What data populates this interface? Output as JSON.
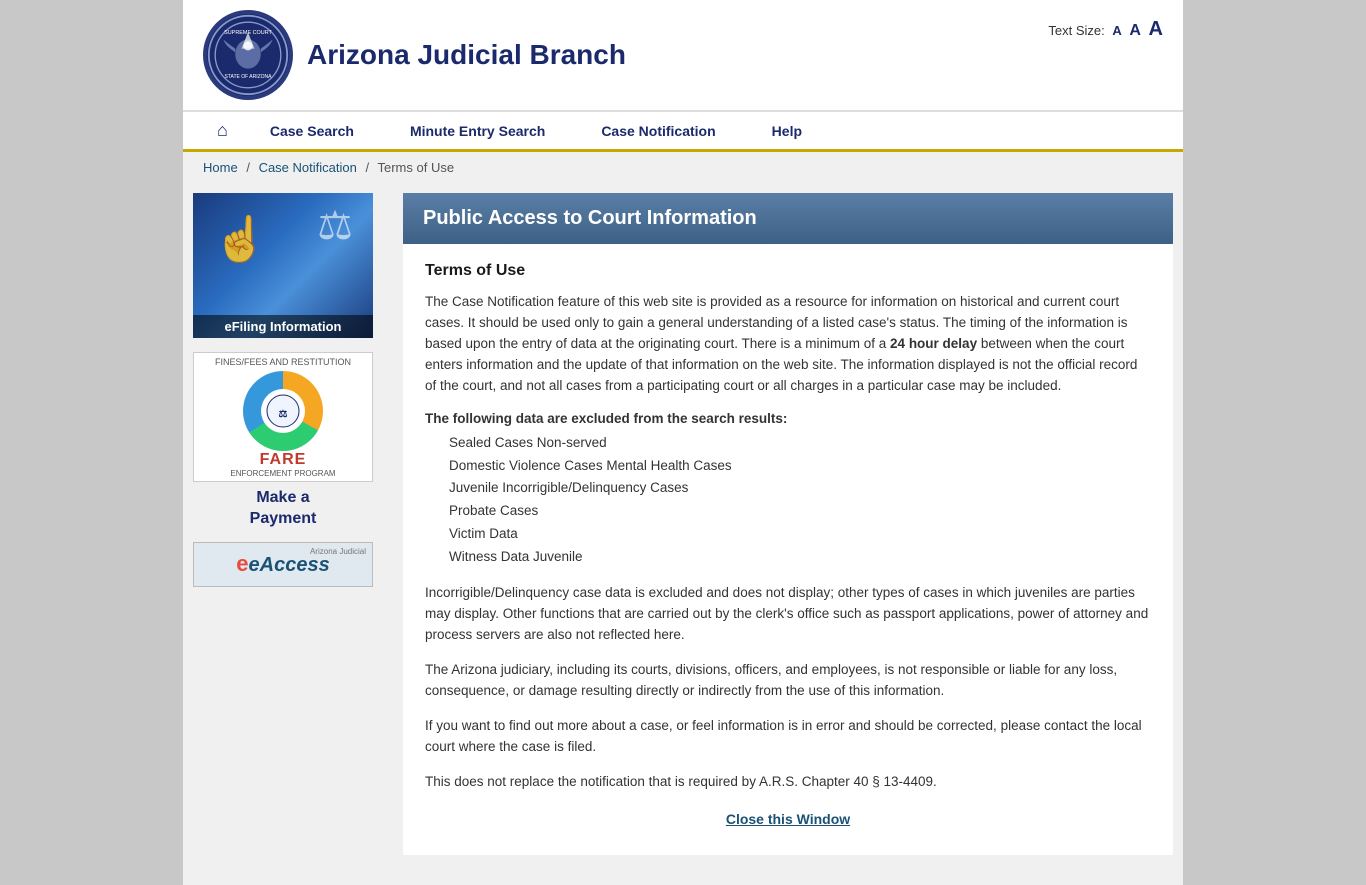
{
  "header": {
    "title": "Arizona Judicial Branch",
    "text_size_label": "Text Size:",
    "text_size_small": "A",
    "text_size_medium": "A",
    "text_size_large": "A"
  },
  "nav": {
    "home_title": "Home",
    "links": [
      {
        "id": "case-search",
        "label": "Case Search"
      },
      {
        "id": "minute-entry-search",
        "label": "Minute Entry Search"
      },
      {
        "id": "case-notification",
        "label": "Case Notification"
      },
      {
        "id": "help",
        "label": "Help"
      }
    ]
  },
  "breadcrumb": {
    "items": [
      "Home",
      "Case Notification",
      "Terms of Use"
    ],
    "separators": [
      "/",
      "/"
    ]
  },
  "sidebar": {
    "efiling_label": "eFiling Information",
    "fare_label_top": "FINES/FEES AND RESTITUTION",
    "fare_name": "FARE",
    "fare_enforcement": "ENFORCEMENT PROGRAM",
    "make_payment_line1": "Make a",
    "make_payment_line2": "Payment",
    "eaccess_label": "eAccess",
    "eaccess_az_label": "Arizona Judicial"
  },
  "main": {
    "page_title": "Public Access to Court Information",
    "terms_heading": "Terms of Use",
    "paragraph1": "The Case Notification feature of this web site is provided as a resource for information on historical and current court cases.  It should be used only to gain a general understanding of a listed case's status. The timing of the information is based upon the entry of data at the originating court. There is a minimum of a",
    "paragraph1_bold": "24 hour delay",
    "paragraph1_cont": "between when the court enters information and the update of that information on the web site. The information displayed is not the official record of the court, and not all cases from a participating court or all charges in a particular case may be included.",
    "excluded_title": "The following data are excluded from the search results:",
    "excluded_items": [
      "Sealed Cases Non-served",
      "Domestic Violence Cases Mental Health Cases",
      "Juvenile Incorrigible/Delinquency Cases",
      "Probate Cases",
      "Victim Data",
      "Witness Data Juvenile"
    ],
    "paragraph2": "Incorrigible/Delinquency case data is excluded and does not display; other types of cases in which juveniles are parties may display. Other functions that are carried out by the clerk's office such as passport applications, power of attorney and process servers are also not reflected here.",
    "paragraph3": "The Arizona judiciary, including its courts, divisions, officers, and employees, is not responsible or liable for any loss, consequence, or damage resulting directly or indirectly from the use of this information.",
    "paragraph4": "If you want to find out more about a case, or feel information is in error and should be corrected, please contact the local court where the case is filed.",
    "paragraph5": "This does not replace the notification that is required by A.R.S. Chapter 40 § 13-4409.",
    "close_link": "Close this Window"
  }
}
